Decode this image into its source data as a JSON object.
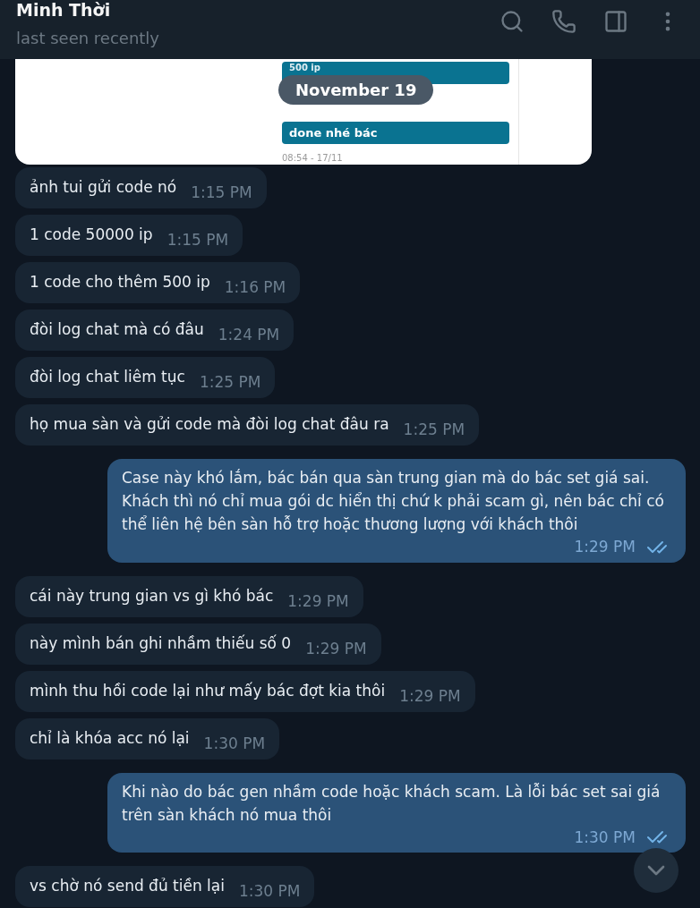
{
  "header": {
    "title": "Minh Thời",
    "status": "last seen recently"
  },
  "image_message": {
    "bubbles": [
      "500 ip",
      "done nhé bác"
    ],
    "timestamps": [
      "08:54 - 17/11"
    ]
  },
  "date_label": "November 19",
  "messages": [
    {
      "kind": "incoming",
      "text": "ảnh tui gửi code nó",
      "time": "1:15 PM"
    },
    {
      "kind": "incoming",
      "text": "1 code 50000 ip",
      "time": "1:15 PM"
    },
    {
      "kind": "incoming",
      "text": "1 code cho thêm 500 ip",
      "time": "1:16 PM"
    },
    {
      "kind": "incoming",
      "text": "đòi log chat mà có đâu",
      "time": "1:24 PM"
    },
    {
      "kind": "incoming",
      "text": "đòi log chat liêm tục",
      "time": "1:25 PM"
    },
    {
      "kind": "incoming",
      "text": "họ mua sàn và gửi code mà đòi log chat đâu ra",
      "time": "1:25 PM"
    },
    {
      "kind": "outgoing",
      "text": "Case này khó lắm, bác bán qua sàn trung gian mà do bác set giá sai. Khách thì nó chỉ mua gói dc hiển thị chứ k phải scam gì, nên bác chỉ có thể liên hệ bên sàn hỗ trợ hoặc thương lượng với khách thôi",
      "time": "1:29 PM",
      "read": true
    },
    {
      "kind": "incoming",
      "text": "cái này trung gian vs gì khó bác",
      "time": "1:29 PM"
    },
    {
      "kind": "incoming",
      "text": "này mình bán ghi nhầm thiếu số 0",
      "time": "1:29 PM"
    },
    {
      "kind": "incoming",
      "text": "mình thu hồi code lại như mấy bác đợt kia thôi",
      "time": "1:29 PM"
    },
    {
      "kind": "incoming",
      "text": "chỉ là khóa acc nó lại",
      "time": "1:30 PM"
    },
    {
      "kind": "outgoing",
      "text": "Khi nào do bác gen nhầm code hoặc khách scam. Là lỗi bác set sai giá trên sàn khách nó mua thôi",
      "time": "1:30 PM",
      "read": true
    },
    {
      "kind": "incoming",
      "text": "vs chờ nó send đủ tiền lại",
      "time": "1:30 PM"
    }
  ]
}
